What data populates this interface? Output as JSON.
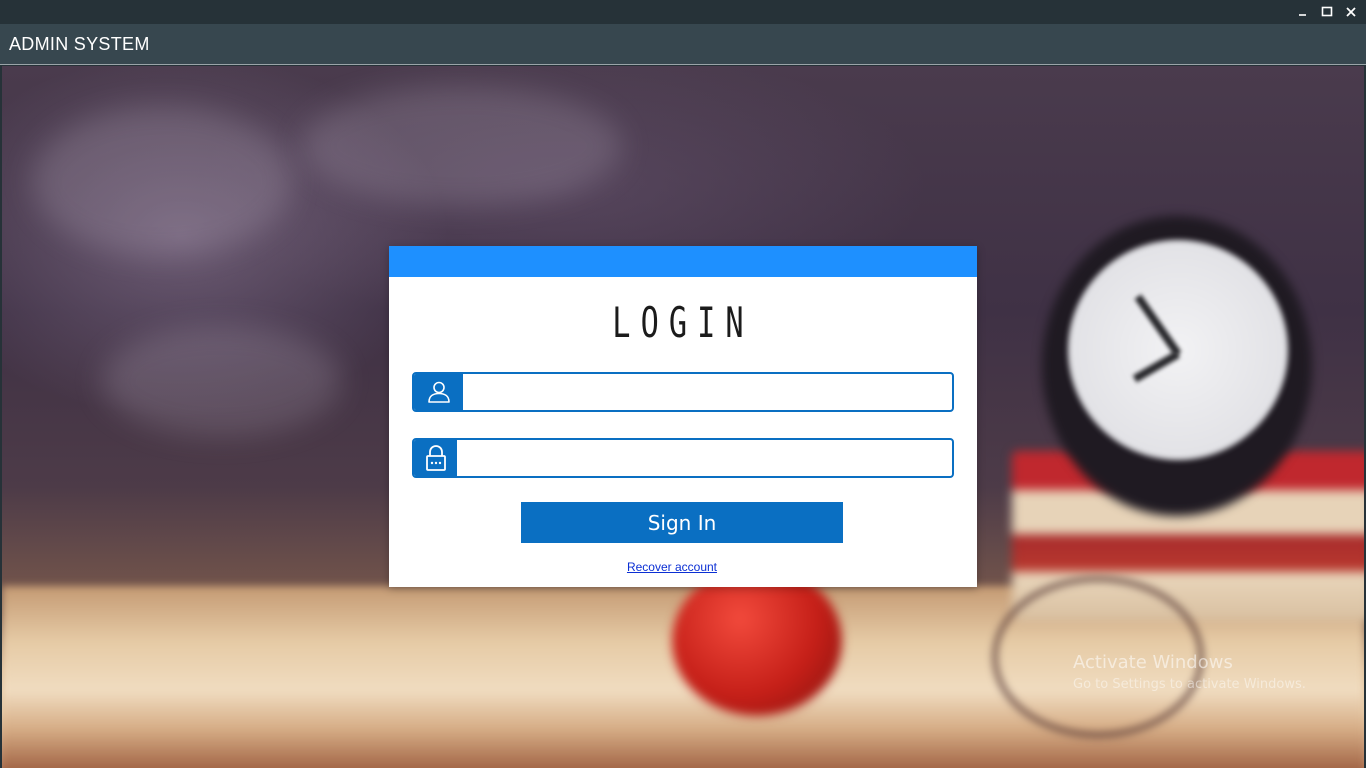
{
  "window": {
    "title": "ADMIN SYSTEM",
    "controls": [
      "minimize-icon",
      "maximize-icon",
      "close-icon"
    ]
  },
  "login": {
    "title": "LOGIN",
    "username": {
      "value": "",
      "placeholder": "",
      "icon": "user-icon"
    },
    "password": {
      "value": "",
      "placeholder": "",
      "icon": "lock-icon"
    },
    "sign_in_label": "Sign In",
    "recover_label": "Recover account"
  },
  "watermark": {
    "title": "Activate Windows",
    "subtitle": "Go to Settings to activate Windows."
  },
  "colors": {
    "header_accent": "#1e90ff",
    "primary": "#0a6fc2",
    "title_bar": "#37474f",
    "top_strip": "#263238",
    "link": "#0b2fd4"
  }
}
